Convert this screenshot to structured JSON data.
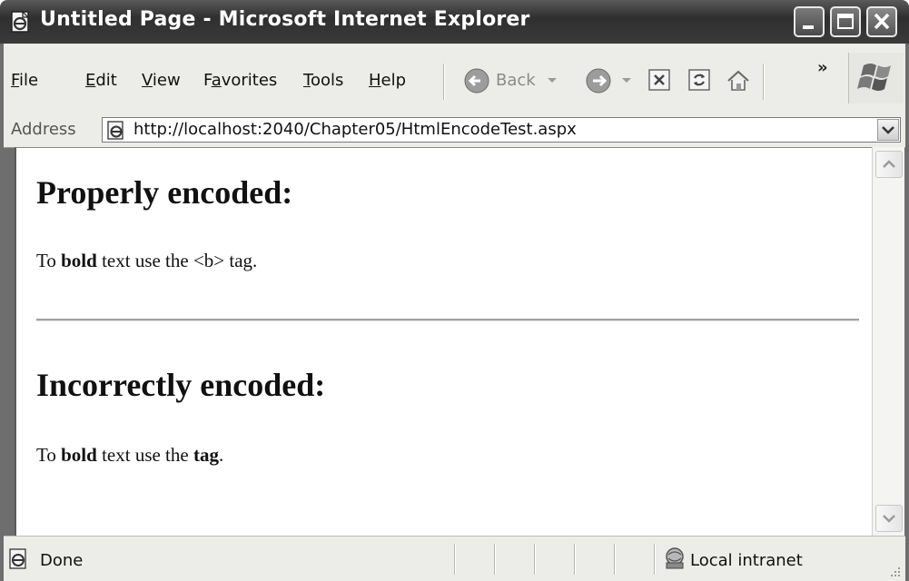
{
  "window": {
    "title": "Untitled Page - Microsoft Internet Explorer",
    "icon": "ie-page-icon"
  },
  "menu": {
    "items": [
      {
        "label": "File",
        "accel": "F",
        "rest": "ile"
      },
      {
        "label": "Edit",
        "accel": "E",
        "rest": "dit"
      },
      {
        "label": "View",
        "accel": "V",
        "rest": "iew"
      },
      {
        "label": "Favorites",
        "accel": "a",
        "pre": "F",
        "rest": "vorites"
      },
      {
        "label": "Tools",
        "accel": "T",
        "rest": "ools"
      },
      {
        "label": "Help",
        "accel": "H",
        "rest": "elp"
      }
    ]
  },
  "toolbar": {
    "back_label": "Back",
    "overflow": "»",
    "icons": [
      "back-icon",
      "forward-icon",
      "stop-icon",
      "refresh-icon",
      "home-icon",
      "windows-logo-icon"
    ]
  },
  "address": {
    "label": "Address",
    "url": "http://localhost:2040/Chapter05/HtmlEncodeTest.aspx"
  },
  "page": {
    "heading1": "Properly encoded:",
    "para1": {
      "a": "To ",
      "b": "bold",
      "c": " text use the <b> tag."
    },
    "heading2": "Incorrectly encoded:",
    "para2": {
      "a": "To ",
      "b": "bold",
      "c": " text use the ",
      "d": "tag",
      "e": "."
    }
  },
  "status": {
    "text": "Done",
    "zone": "Local intranet"
  }
}
